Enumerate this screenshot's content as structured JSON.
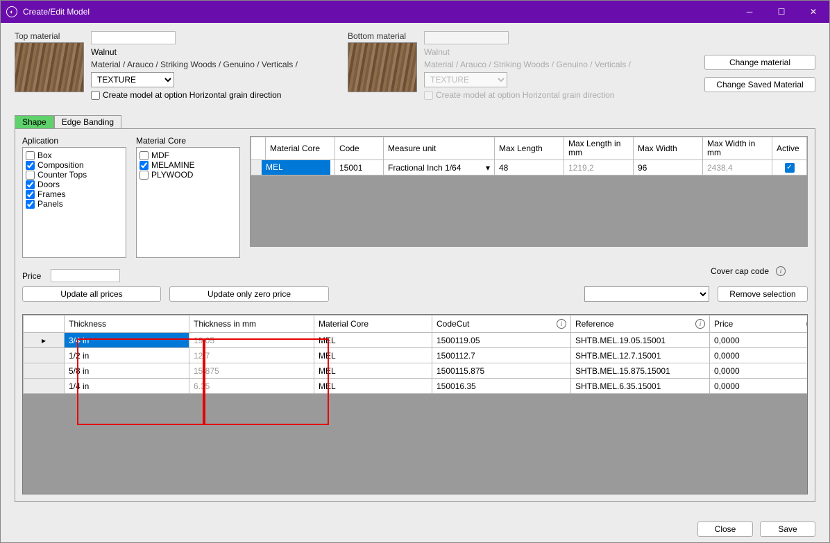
{
  "window": {
    "title": "Create/Edit Model"
  },
  "top_material": {
    "label": "Top material",
    "name": "Walnut",
    "breadcrumb": "Material  / Arauco / Striking Woods / Genuino / Verticals /",
    "texture_select": "TEXTURE",
    "checkbox_label": "Create model at option Horizontal grain direction",
    "checked": false
  },
  "bottom_material": {
    "label": "Bottom material",
    "name": "Walnut",
    "breadcrumb": "Material  / Arauco / Striking Woods / Genuino / Verticals /",
    "texture_select": "TEXTURE",
    "checkbox_label": "Create model at option Horizontal grain direction",
    "disabled": true
  },
  "buttons": {
    "change_material": "Change material",
    "change_saved_material": "Change Saved Material",
    "update_all_prices": "Update all prices",
    "update_only_zero": "Update only zero price",
    "remove_selection": "Remove selection",
    "close": "Close",
    "save": "Save"
  },
  "tabs": {
    "shape": "Shape",
    "edge_banding": "Edge Banding"
  },
  "application": {
    "label": "Aplication",
    "items": [
      {
        "label": "Box",
        "checked": false
      },
      {
        "label": "Composition",
        "checked": true
      },
      {
        "label": "Counter Tops",
        "checked": false
      },
      {
        "label": "Doors",
        "checked": true
      },
      {
        "label": "Frames",
        "checked": true
      },
      {
        "label": "Panels",
        "checked": true
      }
    ]
  },
  "material_core": {
    "label": "Material Core",
    "items": [
      {
        "label": "MDF",
        "checked": false
      },
      {
        "label": "MELAMINE",
        "checked": true
      },
      {
        "label": "PLYWOOD",
        "checked": false
      }
    ]
  },
  "core_table": {
    "headers": [
      "",
      "Material Core",
      "Code",
      "Measure unit",
      "Max Length",
      "Max Length in mm",
      "Max Width",
      "Max Width in mm",
      "Active"
    ],
    "row": {
      "material_core": "MEL",
      "code": "15001",
      "measure_unit": "Fractional Inch 1/64",
      "max_length": "48",
      "max_length_mm": "1219,2",
      "max_width": "96",
      "max_width_mm": "2438,4",
      "active": true
    }
  },
  "price_label": "Price",
  "cover_cap_label": "Cover cap code",
  "thickness_table": {
    "headers": [
      "",
      "Thickness",
      "Thickness in mm",
      "Material Core",
      "CodeCut",
      "Reference",
      "Price"
    ],
    "rows": [
      {
        "thickness": "3/4 in",
        "thickness_mm": "19.05",
        "core": "MEL",
        "codecut": "1500119.05",
        "reference": "SHTB.MEL.19.05.15001",
        "price": "0,0000",
        "selected": true
      },
      {
        "thickness": "1/2 in",
        "thickness_mm": "12.7",
        "core": "MEL",
        "codecut": "1500112.7",
        "reference": "SHTB.MEL.12.7.15001",
        "price": "0,0000"
      },
      {
        "thickness": "5/8 in",
        "thickness_mm": "15.875",
        "core": "MEL",
        "codecut": "1500115.875",
        "reference": "SHTB.MEL.15.875.15001",
        "price": "0,0000"
      },
      {
        "thickness": "1/4 in",
        "thickness_mm": "6.35",
        "core": "MEL",
        "codecut": "150016.35",
        "reference": "SHTB.MEL.6.35.15001",
        "price": "0,0000"
      }
    ]
  }
}
